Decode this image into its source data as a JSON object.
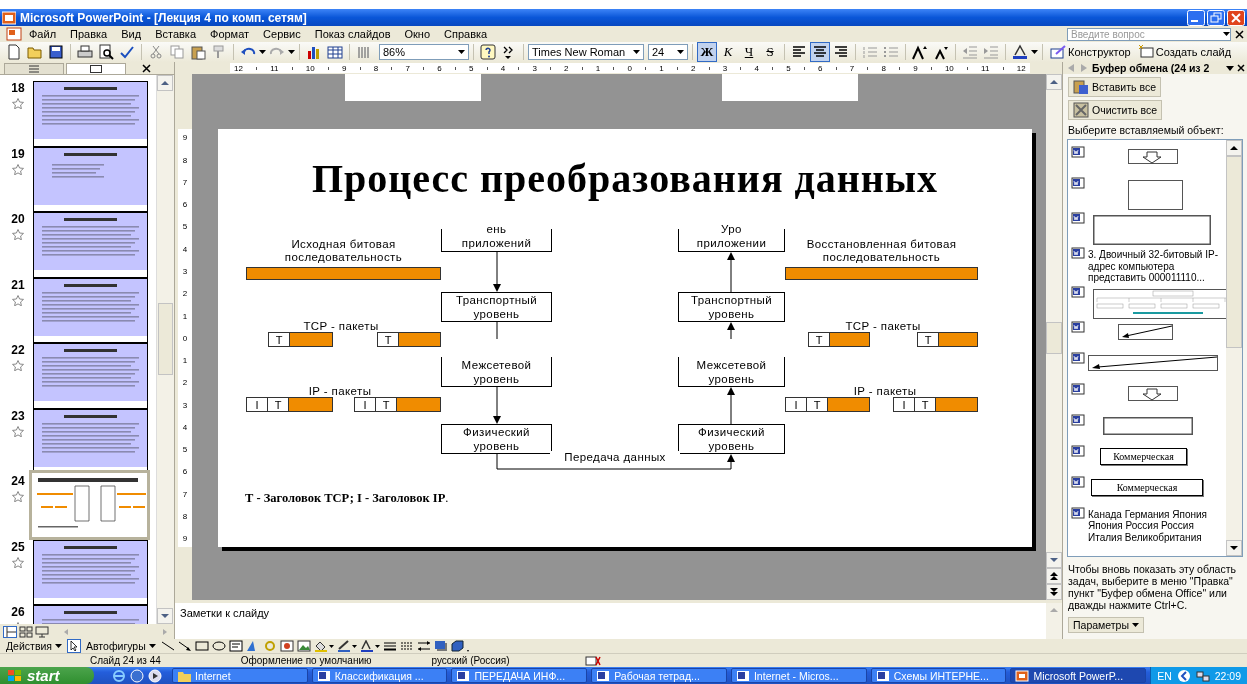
{
  "window": {
    "title": "Microsoft PowerPoint - [Лекция 4 по комп. сетям]"
  },
  "menu": [
    "Файл",
    "Правка",
    "Вид",
    "Вставка",
    "Формат",
    "Сервис",
    "Показ слайдов",
    "Окно",
    "Справка"
  ],
  "help_box": {
    "placeholder": "Введите вопрос"
  },
  "toolbar": {
    "zoom": "86%",
    "font": "Times New Roman",
    "size": "24",
    "styles": [
      {
        "label": "Ж",
        "selected": true
      },
      {
        "label": "К",
        "selected": false
      },
      {
        "label": "Ч",
        "selected": false
      },
      {
        "label": "S",
        "selected": false
      }
    ],
    "alignment": [
      {
        "kind": "left",
        "selected": false
      },
      {
        "kind": "center",
        "selected": true
      },
      {
        "kind": "right",
        "selected": false
      }
    ],
    "design_button": "Конструктор",
    "new_slide_button": "Создать слайд"
  },
  "ruler": {
    "horizontal": [
      "12",
      "11",
      "10",
      "9",
      "8",
      "7",
      "6",
      "5",
      "4",
      "3",
      "2",
      "1",
      "0",
      "1",
      "2",
      "3",
      "4",
      "5",
      "6",
      "7",
      "8",
      "9",
      "10",
      "11",
      "12"
    ],
    "vertical": [
      "9",
      "8",
      "7",
      "6",
      "5",
      "4",
      "3",
      "2",
      "1",
      "0",
      "1",
      "2",
      "3",
      "4",
      "5",
      "6",
      "7",
      "8",
      "9"
    ]
  },
  "slides_pane": {
    "thumbnails": [
      {
        "number": "18",
        "kind": "text",
        "selected": false
      },
      {
        "number": "19",
        "kind": "list",
        "selected": false
      },
      {
        "number": "20",
        "kind": "text",
        "selected": false
      },
      {
        "number": "21",
        "kind": "text",
        "selected": false
      },
      {
        "number": "22",
        "kind": "text",
        "selected": false
      },
      {
        "number": "23",
        "kind": "text",
        "selected": false
      },
      {
        "number": "24",
        "kind": "diagram",
        "selected": true
      },
      {
        "number": "25",
        "kind": "text",
        "selected": false
      },
      {
        "number": "26",
        "kind": "text",
        "selected": false
      }
    ]
  },
  "slide": {
    "title": "Процесс преобразования данных",
    "sender": {
      "caption": "Исходная битовая последовательность",
      "layers": [
        "ень\nприложений",
        "Транспортный\nуровень",
        "Межсетевой\nуровень",
        "Физический\nуровень"
      ],
      "tcp_label": "TCP - пакеты",
      "tcp_packets": [
        [
          "Т"
        ],
        [
          "Т"
        ]
      ],
      "ip_label": "IP - пакеты",
      "ip_packets": [
        [
          "I",
          "Т"
        ],
        [
          "I",
          "Т"
        ]
      ]
    },
    "receiver": {
      "caption": "Восстановленная битовая последовательность",
      "layers": [
        "Уро\nприложении",
        "Транспортный\nуровень",
        "Межсетевой\nуровень",
        "Физический\nуровень"
      ],
      "tcp_label": "TCP - пакеты",
      "tcp_packets": [
        [
          "Т"
        ],
        [
          "Т"
        ]
      ],
      "ip_label": "IP - пакеты",
      "ip_packets": [
        [
          "I",
          "Т"
        ],
        [
          "I",
          "Т"
        ]
      ]
    },
    "link_label": "Передача данных",
    "legend": "**Т - Заголовок ТСР; I - Заголовок IP**."
  },
  "notes": {
    "placeholder": "Заметки к слайду"
  },
  "task_pane": {
    "title": "Буфер обмена (24 из 2",
    "buttons": [
      "Вставить все",
      "Очистить все"
    ],
    "prompt": "Выберите вставляемый объект:",
    "items": [
      {
        "kind": "blockarrow"
      },
      {
        "kind": "square"
      },
      {
        "kind": "frame"
      },
      {
        "kind": "text",
        "text": "3. Двоичный 32-битовый IP-адрес компьютера представить 000011110..."
      },
      {
        "kind": "chart"
      },
      {
        "kind": "arrow"
      },
      {
        "kind": "longarrow"
      },
      {
        "kind": "blockarrow"
      },
      {
        "kind": "bar"
      },
      {
        "kind": "label",
        "text": "Коммерческая"
      },
      {
        "kind": "label",
        "text": "Коммерческая"
      },
      {
        "kind": "text",
        "text": "Канада Германия Япония Япония Россия Россия Италия Великобритания"
      }
    ],
    "hint": "Чтобы вновь показать эту область задач, выберите в меню \"Правка\" пункт \"Буфер обмена Office\" или дважды нажмите Ctrl+C.",
    "options_button": "Параметры"
  },
  "drawing_toolbar": {
    "actions": "Действия",
    "autoshapes": "Автофигуры"
  },
  "status_bar": [
    "Слайд 24 из 44",
    "Оформление по умолчанию",
    "русский (Россия)"
  ],
  "taskbar": {
    "start": "start",
    "tasks": [
      {
        "label": "Internet",
        "kind": "folder",
        "selected": false
      },
      {
        "label": "Классификация ...",
        "kind": "word",
        "selected": false
      },
      {
        "label": "ПЕРЕДАЧА ИНФ...",
        "kind": "word",
        "selected": false
      },
      {
        "label": "Рабочая тетрад...",
        "kind": "word",
        "selected": false
      },
      {
        "label": "Internet - Micros...",
        "kind": "word",
        "selected": false
      },
      {
        "label": "Схемы ИНТЕРНЕ...",
        "kind": "word",
        "selected": false
      },
      {
        "label": "Microsoft PowerP...",
        "kind": "powerpoint",
        "selected": true
      }
    ],
    "language": "EN",
    "clock": "22:09"
  }
}
